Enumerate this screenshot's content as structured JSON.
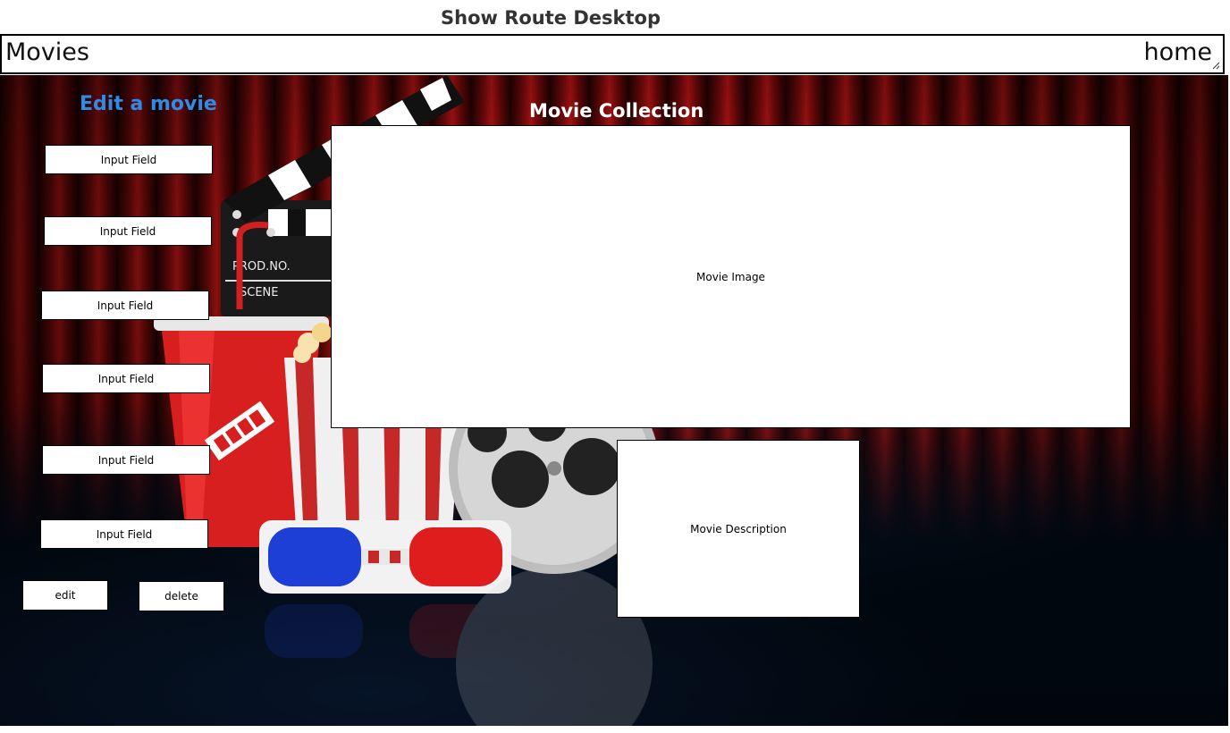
{
  "frame": {
    "title": "Show Route Desktop"
  },
  "nav": {
    "brand": "Movies",
    "home_link": "home"
  },
  "edit_form": {
    "title": "Edit a movie",
    "fields": [
      "Input Field",
      "Input Field",
      "Input Field",
      "Input Field",
      "Input Field",
      "Input Field"
    ],
    "edit_label": "edit",
    "delete_label": "delete"
  },
  "collection": {
    "title": "Movie Collection",
    "image_label": "Movie Image",
    "description_label": "Movie Description"
  },
  "clapper_text": {
    "prod": "PROD.NO.",
    "scene": "SCENE"
  },
  "colors": {
    "edit_title": "#2f8be6",
    "collection_title": "#ffffff",
    "curtain": "#8c0d0d",
    "floor": "#031a33"
  }
}
